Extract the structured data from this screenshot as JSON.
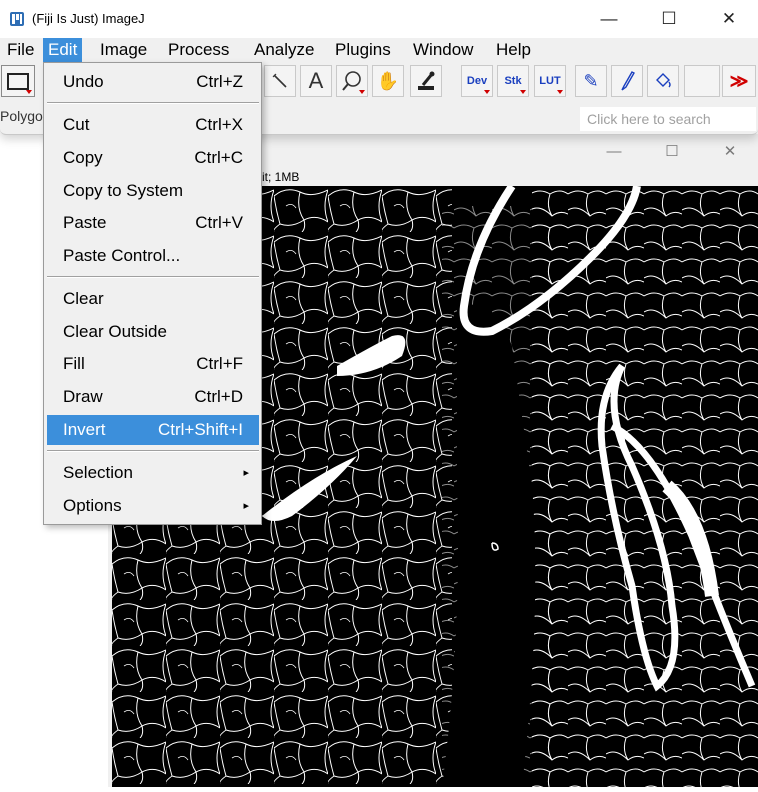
{
  "window": {
    "title": "(Fiji Is Just) ImageJ",
    "minimize": "—",
    "maximize": "☐",
    "close": "✕"
  },
  "menubar": [
    "File",
    "Edit",
    "Image",
    "Process",
    "Analyze",
    "Plugins",
    "Window",
    "Help"
  ],
  "toolbar": {
    "tools": [
      {
        "name": "rectangle-tool",
        "glyph": "▭"
      },
      {
        "name": "line-tool",
        "glyph": "⟋"
      },
      {
        "name": "text-tool",
        "glyph": "A"
      },
      {
        "name": "magnifier-tool",
        "glyph": "⌕"
      },
      {
        "name": "hand-tool",
        "glyph": "✋"
      },
      {
        "name": "color-picker-tool",
        "glyph": "⊿"
      },
      {
        "name": "dev-tool",
        "label": "Dev"
      },
      {
        "name": "stk-tool",
        "label": "Stk"
      },
      {
        "name": "lut-tool",
        "label": "LUT"
      },
      {
        "name": "pencil-tool",
        "glyph": "✎"
      },
      {
        "name": "brush-tool",
        "glyph": "⟋"
      },
      {
        "name": "flood-fill-tool",
        "glyph": "⛋"
      },
      {
        "name": "more-tools",
        "glyph": "≫"
      }
    ],
    "current_tool_text": "Polygo",
    "search_placeholder": "Click here to search"
  },
  "image_window": {
    "info": "it; 1MB",
    "minimize": "—",
    "maximize": "☐",
    "close": "✕"
  },
  "edit_menu": {
    "items": [
      {
        "label": "Undo",
        "shortcut": "Ctrl+Z"
      },
      {
        "label": "Cut",
        "shortcut": "Ctrl+X"
      },
      {
        "label": "Copy",
        "shortcut": "Ctrl+C"
      },
      {
        "label": "Copy to System",
        "shortcut": ""
      },
      {
        "label": "Paste",
        "shortcut": "Ctrl+V"
      },
      {
        "label": "Paste Control...",
        "shortcut": ""
      },
      {
        "label": "Clear",
        "shortcut": ""
      },
      {
        "label": "Clear Outside",
        "shortcut": ""
      },
      {
        "label": "Fill",
        "shortcut": "Ctrl+F"
      },
      {
        "label": "Draw",
        "shortcut": "Ctrl+D"
      },
      {
        "label": "Invert",
        "shortcut": "Ctrl+Shift+I"
      },
      {
        "label": "Selection",
        "shortcut": "",
        "submenu": true
      },
      {
        "label": "Options",
        "shortcut": "",
        "submenu": true
      }
    ],
    "highlighted": "Invert",
    "submenu_arrow": "▸"
  },
  "colors": {
    "accent": "#3c8fdb",
    "menu_bg": "#f0f0f0",
    "canvas_bg": "#000000",
    "cell_outline": "#ffffff"
  }
}
